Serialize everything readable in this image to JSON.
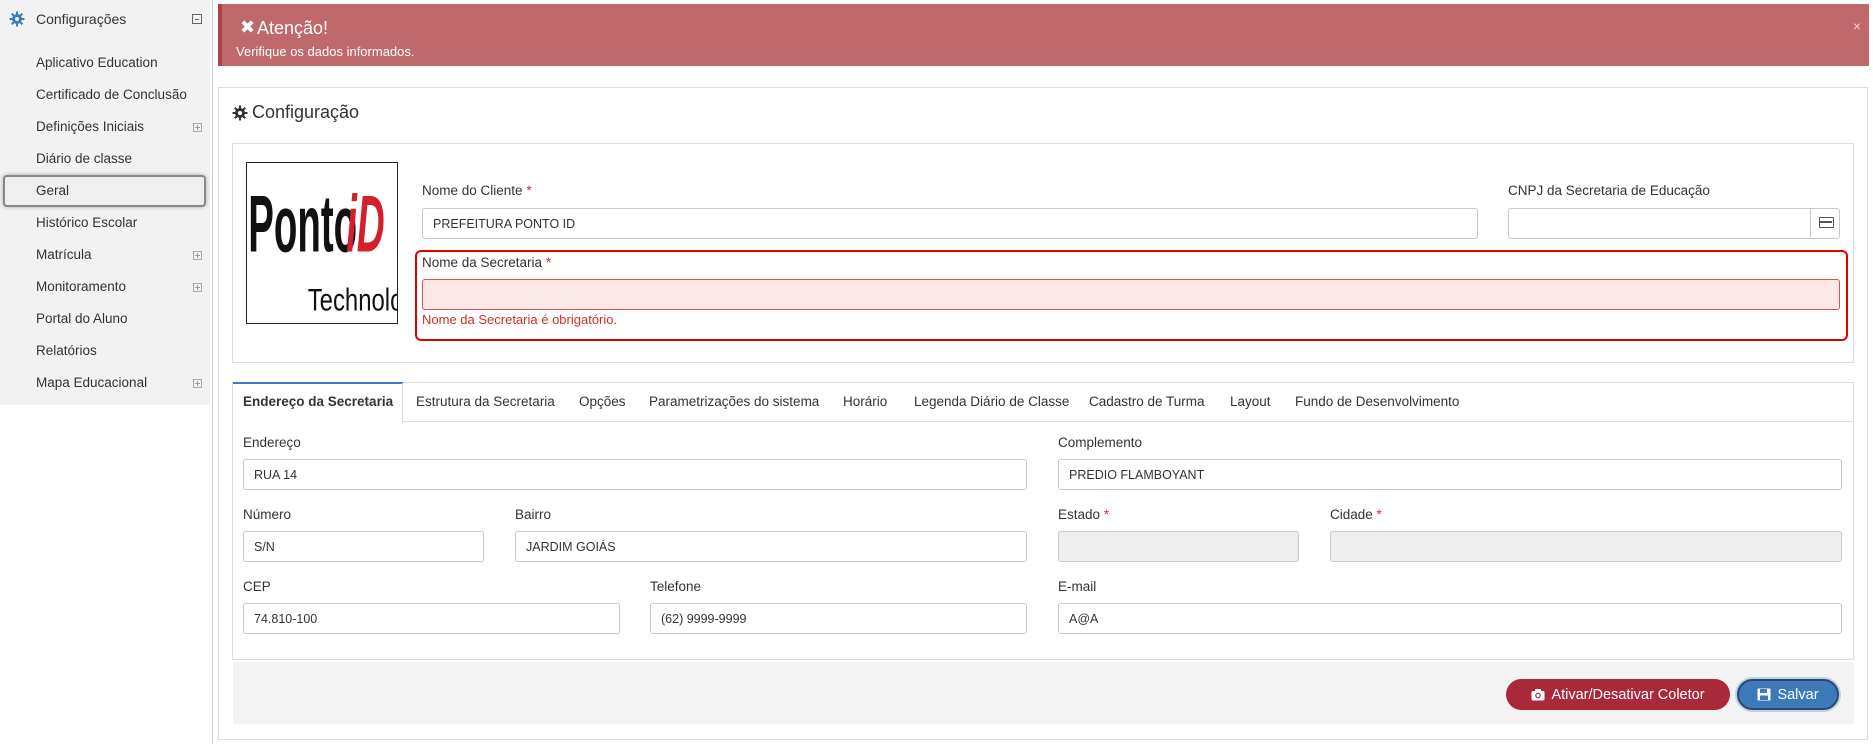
{
  "sidebar": {
    "title": "Configurações",
    "items": [
      {
        "label": "Aplicativo Education",
        "expandable": false
      },
      {
        "label": "Certificado de Conclusão",
        "expandable": false
      },
      {
        "label": "Definições Iniciais",
        "expandable": true
      },
      {
        "label": "Diário de classe",
        "expandable": false
      },
      {
        "label": "Geral",
        "expandable": false,
        "active": true
      },
      {
        "label": "Histórico Escolar",
        "expandable": false
      },
      {
        "label": "Matrícula",
        "expandable": true
      },
      {
        "label": "Monitoramento",
        "expandable": true
      },
      {
        "label": "Portal do Aluno",
        "expandable": false
      },
      {
        "label": "Relatórios",
        "expandable": false
      },
      {
        "label": "Mapa Educacional",
        "expandable": true
      }
    ]
  },
  "alert": {
    "title": "Atenção!",
    "message": "Verifique os dados informados.",
    "close": "×"
  },
  "panel": {
    "title": "Configuração"
  },
  "logo": {
    "brand_main": "Ponto",
    "brand_accent": "iD",
    "brand_sub": "Technology"
  },
  "form": {
    "cliente_label": "Nome do Cliente",
    "cliente_value": "PREFEITURA PONTO ID",
    "cnpj_label": "CNPJ da Secretaria de Educação",
    "cnpj_value": "",
    "secretaria_label": "Nome da Secretaria",
    "secretaria_value": "",
    "secretaria_error": "Nome da Secretaria é obrigatório.",
    "required_mark": "*"
  },
  "tabs": [
    "Endereço da Secretaria",
    "Estrutura da Secretaria",
    "Opções",
    "Parametrizações do sistema",
    "Horário",
    "Legenda Diário de Classe",
    "Cadastro de Turma",
    "Layout",
    "Fundo de Desenvolvimento"
  ],
  "address": {
    "endereco_label": "Endereço",
    "endereco_value": "RUA 14",
    "complemento_label": "Complemento",
    "complemento_value": "PREDIO FLAMBOYANT",
    "numero_label": "Número",
    "numero_value": "S/N",
    "bairro_label": "Bairro",
    "bairro_value": "JARDIM GOIÁS",
    "estado_label": "Estado",
    "estado_value": "",
    "cidade_label": "Cidade",
    "cidade_value": "",
    "cep_label": "CEP",
    "cep_value": "74.810-100",
    "telefone_label": "Telefone",
    "telefone_value": "(62) 9999-9999",
    "email_label": "E-mail",
    "email_value": "A@A"
  },
  "buttons": {
    "coletor": "Ativar/Desativar Coletor",
    "salvar": "Salvar"
  },
  "colors": {
    "alert_bg": "#c0696a",
    "accent_blue": "#3d7ab9",
    "danger": "#a9283a",
    "error_text": "#c9302c"
  }
}
